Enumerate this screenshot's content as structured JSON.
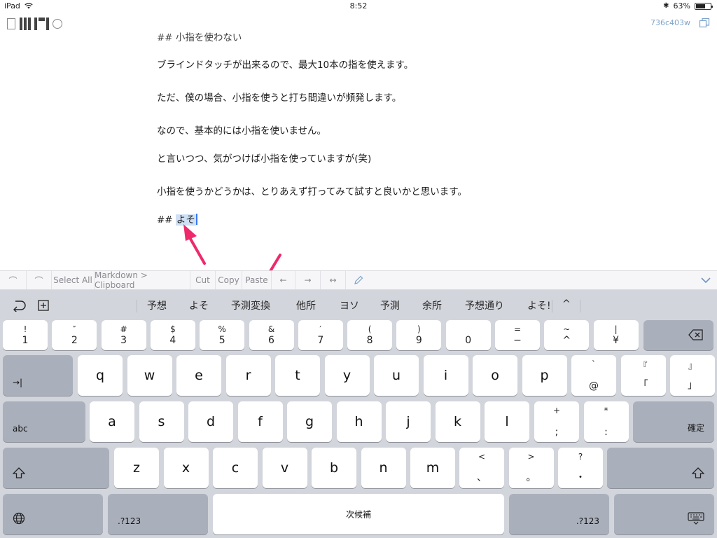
{
  "status": {
    "device": "iPad",
    "time": "8:52",
    "battery": "63%",
    "battery_level": 0.63
  },
  "app": {
    "hash": "736c403w"
  },
  "editor": {
    "lines": [
      "## 小指を使わない",
      "ブラインドタッチが出来るので、最大10本の指を使えます。",
      "ただ、僕の場合、小指を使うと打ち間違いが頻発します。",
      "なので、基本的には小指を使いません。",
      "と言いつつ、気がつけば小指を使っていますが(笑)",
      "小指を使うかどうかは、とりあえず打ってみて試すと良いかと思います。"
    ],
    "heading_prefix": "## ",
    "heading_selected": "よそ"
  },
  "toolbar": {
    "undo": "⌒",
    "redo": "⌒",
    "select_all": "Select All",
    "markdown_clipboard": "Markdown > Clipboard",
    "cut": "Cut",
    "copy": "Copy",
    "paste": "Paste",
    "left": "←",
    "right": "→",
    "leftright": "↔"
  },
  "candidates": [
    "予想",
    "よそ",
    "予測変換",
    "他所",
    "ヨソ",
    "予測",
    "余所",
    "予想通り",
    "よそ!",
    "^"
  ],
  "keys": {
    "num_row": [
      {
        "top": "!",
        "bot": "1"
      },
      {
        "top": "″",
        "bot": "2"
      },
      {
        "top": "#",
        "bot": "3"
      },
      {
        "top": "$",
        "bot": "4"
      },
      {
        "top": "%",
        "bot": "5"
      },
      {
        "top": "&",
        "bot": "6"
      },
      {
        "top": "′",
        "bot": "7"
      },
      {
        "top": "(",
        "bot": "8"
      },
      {
        "top": ")",
        "bot": "9"
      },
      {
        "top": "",
        "bot": "0"
      },
      {
        "top": "=",
        "bot": "−"
      },
      {
        "top": "~",
        "bot": "^"
      },
      {
        "top": "|",
        "bot": "¥"
      }
    ],
    "row_q": [
      "q",
      "w",
      "e",
      "r",
      "t",
      "y",
      "u",
      "i",
      "o",
      "p"
    ],
    "row_q_extra": [
      {
        "top": "`",
        "bot": "@"
      },
      {
        "top": "『",
        "bot": "「"
      },
      {
        "top": "』",
        "bot": "」"
      }
    ],
    "row_a": [
      "a",
      "s",
      "d",
      "f",
      "g",
      "h",
      "j",
      "k",
      "l"
    ],
    "row_a_extra": [
      {
        "top": "+",
        "bot": ";"
      },
      {
        "top": "*",
        "bot": ":"
      }
    ],
    "row_z": [
      "z",
      "x",
      "c",
      "v",
      "b",
      "n",
      "m"
    ],
    "row_z_extra": [
      {
        "top": "<",
        "bot": "、"
      },
      {
        "top": ">",
        "bot": "。"
      },
      {
        "top": "?",
        "bot": "・"
      }
    ],
    "tab": "→|",
    "abc": "abc",
    "confirm": "確定",
    "space": "次候補",
    "num_left": ".?123",
    "num_right": ".?123"
  }
}
